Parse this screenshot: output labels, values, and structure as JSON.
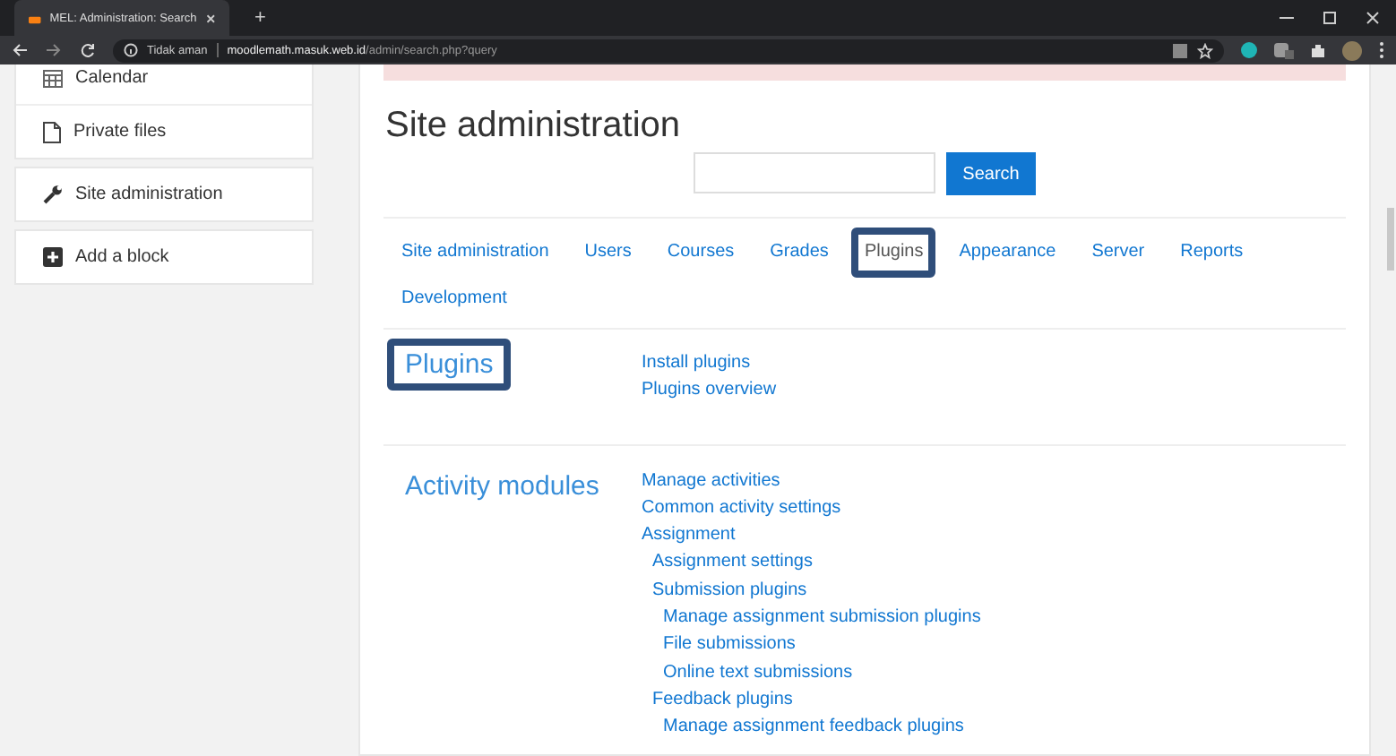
{
  "browser": {
    "tab_title": "MEL: Administration: Search",
    "new_tab": "+",
    "security": "Tidak aman",
    "domain": "moodlemath.masuk.web.id",
    "path": "/admin/search.php?query"
  },
  "sidebar": {
    "blocks": [
      {
        "items": [
          {
            "label": "Calendar"
          },
          {
            "label": "Private files"
          }
        ]
      },
      {
        "items": [
          {
            "label": "Site administration"
          }
        ]
      },
      {
        "items": [
          {
            "label": "Add a block"
          }
        ]
      }
    ]
  },
  "page": {
    "title": "Site administration",
    "search": {
      "button": "Search"
    },
    "tabs": [
      {
        "label": "Site administration",
        "selected": false,
        "highlighted": false
      },
      {
        "label": "Users",
        "selected": false,
        "highlighted": false
      },
      {
        "label": "Courses",
        "selected": false,
        "highlighted": false
      },
      {
        "label": "Grades",
        "selected": false,
        "highlighted": false
      },
      {
        "label": "Plugins",
        "selected": true,
        "highlighted": true
      },
      {
        "label": "Appearance",
        "selected": false,
        "highlighted": false
      },
      {
        "label": "Server",
        "selected": false,
        "highlighted": false
      },
      {
        "label": "Reports",
        "selected": false,
        "highlighted": false
      },
      {
        "label": "Development",
        "selected": false,
        "highlighted": false
      }
    ],
    "sections": [
      {
        "heading": "Plugins",
        "highlighted": true,
        "links": [
          {
            "label": "Install plugins"
          },
          {
            "label": "Plugins overview"
          }
        ]
      },
      {
        "heading": "Activity modules",
        "highlighted": false,
        "links": [
          {
            "label": "Manage activities"
          },
          {
            "label": "Common activity settings"
          },
          {
            "label": "Assignment",
            "children": [
              {
                "label": "Assignment settings"
              },
              {
                "label": "Submission plugins",
                "children": [
                  {
                    "label": "Manage assignment submission plugins"
                  },
                  {
                    "label": "File submissions"
                  },
                  {
                    "label": "Online text submissions"
                  }
                ]
              },
              {
                "label": "Feedback plugins",
                "children": [
                  {
                    "label": "Manage assignment feedback plugins"
                  }
                ]
              }
            ]
          }
        ]
      }
    ]
  }
}
